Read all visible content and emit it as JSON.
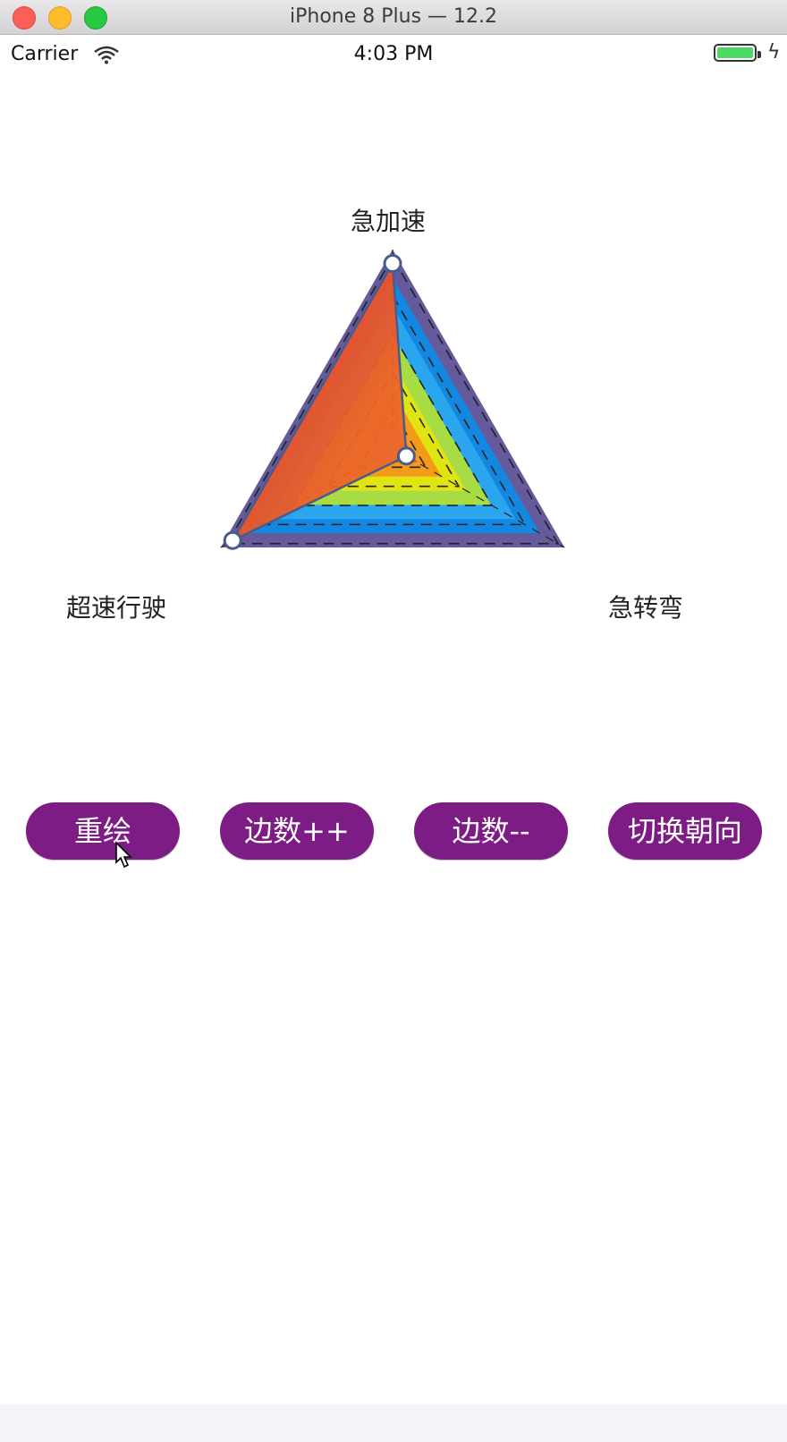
{
  "window": {
    "title": "iPhone 8 Plus — 12.2"
  },
  "status_bar": {
    "carrier": "Carrier",
    "time": "4:03 PM",
    "battery_level": 1.0,
    "charging": true
  },
  "radar": {
    "axes": [
      "急加速",
      "急转弯",
      "超速行驶"
    ],
    "values": [
      0.93,
      0.08,
      0.93
    ],
    "value_max": 1.0,
    "levels": 5,
    "ring_colors": [
      "#645a9c",
      "#1488e0",
      "#2aa6ee",
      "#a8dc44",
      "#e0e410",
      "#f59a18",
      "#e8543a"
    ],
    "fill_gradient": [
      "#e4312a",
      "#ee7a2a"
    ],
    "outline_color": "#4a5b8c",
    "point_color": "#ffffff"
  },
  "buttons": {
    "redraw": "重绘",
    "sides_inc": "边数++",
    "sides_dec": "边数--",
    "toggle_orientation": "切换朝向"
  },
  "colors": {
    "button_bg": "#7d1c84",
    "button_text": "#ffffff"
  }
}
